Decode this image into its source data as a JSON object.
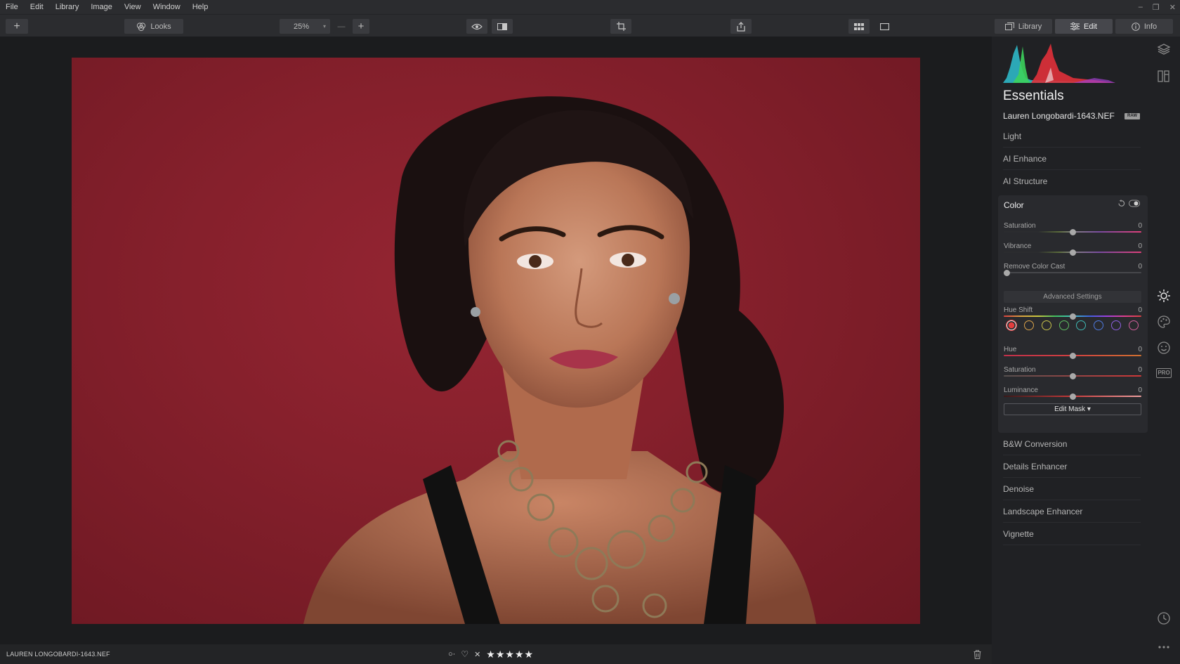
{
  "menu": [
    "File",
    "Edit",
    "Library",
    "Image",
    "View",
    "Window",
    "Help"
  ],
  "window_controls": [
    "–",
    "❐",
    "✕"
  ],
  "toolbar": {
    "add_label": "+",
    "looks_label": "Looks",
    "zoom_value": "25%",
    "zoom_minus": "—",
    "zoom_plus": "+",
    "tabs": {
      "library": "Library",
      "edit": "Edit",
      "info": "Info"
    }
  },
  "panel": {
    "title": "Essentials",
    "filename": "Lauren Longobardi-1643.NEF",
    "raw_badge": "RAW",
    "sections_top": [
      "Light",
      "AI Enhance",
      "AI Structure"
    ],
    "color": {
      "title": "Color",
      "saturation": {
        "label": "Saturation",
        "value": "0"
      },
      "vibrance": {
        "label": "Vibrance",
        "value": "0"
      },
      "remove_cast": {
        "label": "Remove Color Cast",
        "value": "0"
      },
      "advanced_label": "Advanced Settings",
      "hue_shift": {
        "label": "Hue Shift",
        "value": "0"
      },
      "swatch_colors": [
        "#e14b4b",
        "#d9a24a",
        "#c7c24a",
        "#5fbf62",
        "#3fb9b3",
        "#4f7ae0",
        "#8d5fe0",
        "#d05f9b"
      ],
      "hue": {
        "label": "Hue",
        "value": "0"
      },
      "sat2": {
        "label": "Saturation",
        "value": "0"
      },
      "luminance": {
        "label": "Luminance",
        "value": "0"
      },
      "edit_mask_label": "Edit Mask ▾"
    },
    "sections_bottom": [
      "B&W Conversion",
      "Details Enhancer",
      "Denoise",
      "Landscape Enhancer",
      "Vignette"
    ],
    "rail_pro_label": "PRO"
  },
  "bottom": {
    "filename": "LAUREN LONGOBARDI-1643.NEF",
    "stars": "★★★★★"
  },
  "colors": {
    "accent_swatch_active": "#e14b4b",
    "backdrop_red": "#86202c"
  }
}
